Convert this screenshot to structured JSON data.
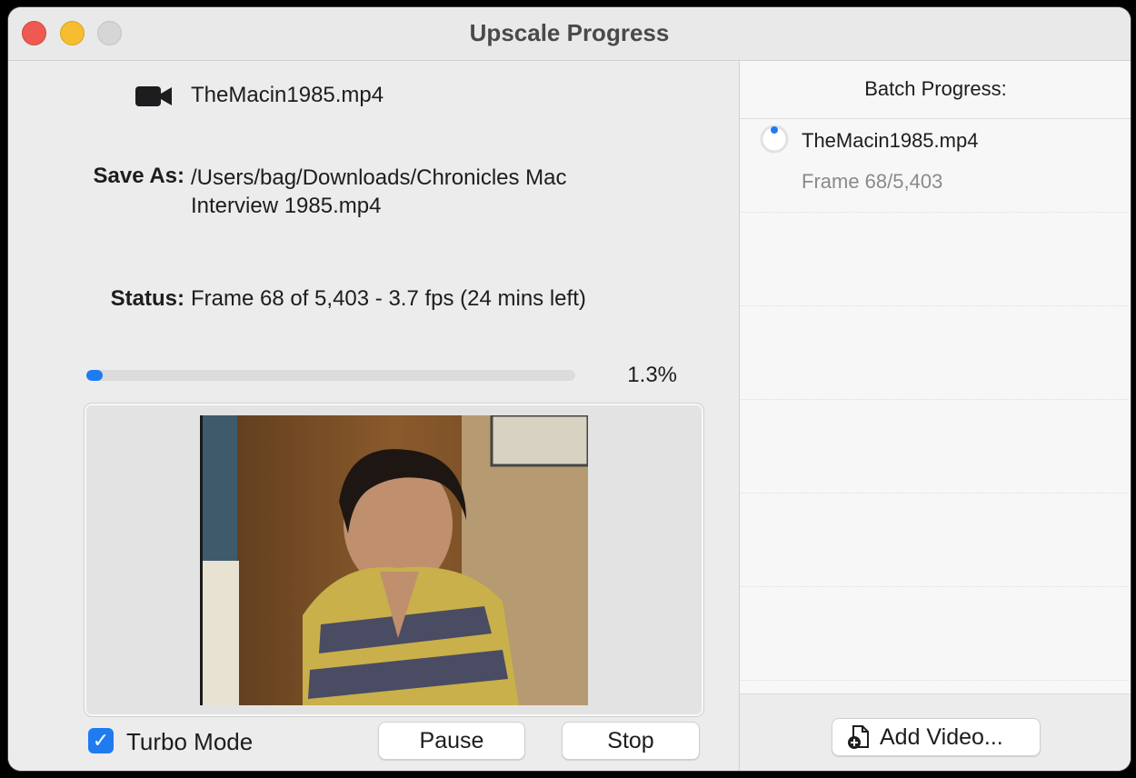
{
  "window": {
    "title": "Upscale Progress"
  },
  "job": {
    "file_name": "TheMacin1985.mp4",
    "save_as_label": "Save As:",
    "save_as_path": "/Users/bag/Downloads/Chronicles Mac Interview 1985.mp4",
    "status_label": "Status:",
    "status_text": "Frame 68 of 5,403 - 3.7 fps (24 mins left)",
    "progress_text": "1.3%",
    "progress_fraction": 0.013
  },
  "controls": {
    "turbo_label": "Turbo Mode",
    "turbo_checked": true,
    "pause_label": "Pause",
    "stop_label": "Stop"
  },
  "batch": {
    "header": "Batch Progress:",
    "items": [
      {
        "file": "TheMacin1985.mp4",
        "frame": "Frame 68/5,403"
      }
    ],
    "add_label": "Add Video..."
  },
  "icons": {
    "camera": "video-camera-icon",
    "spinner": "progress-spinner-icon",
    "add": "add-document-icon",
    "check": "checkmark-icon"
  },
  "colors": {
    "accent": "#1f7bf0",
    "close": "#ee5a52",
    "minimize": "#f5bd2f",
    "zoom": "#d6d6d6"
  }
}
